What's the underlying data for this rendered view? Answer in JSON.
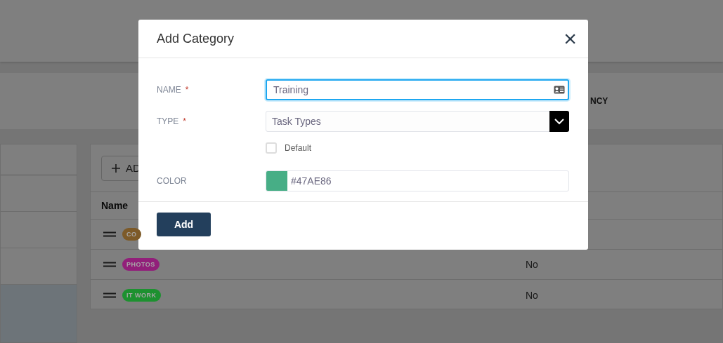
{
  "background": {
    "strip_heading": "NCY",
    "add_button": "AD",
    "table": {
      "header": "Name",
      "rows": [
        {
          "tag": "CO",
          "color": "#7d5a28",
          "value": ""
        },
        {
          "tag": "PHOTOS",
          "color": "#921f7a",
          "value": "No"
        },
        {
          "tag": "IT WORK",
          "color": "#1d9130",
          "value": "No"
        }
      ]
    }
  },
  "dialog": {
    "title": "Add Category",
    "close": "×",
    "fields": [
      {
        "kind": "text",
        "label": "NAME",
        "required_mark": "*",
        "value": "Training"
      },
      {
        "kind": "select",
        "label": "TYPE",
        "required_mark": "*",
        "value": "Task Types"
      },
      {
        "kind": "checkbox",
        "label": "Default",
        "checked": false
      },
      {
        "kind": "color",
        "label": "COLOR",
        "value": "#47AE86"
      }
    ],
    "submit": "Add"
  }
}
